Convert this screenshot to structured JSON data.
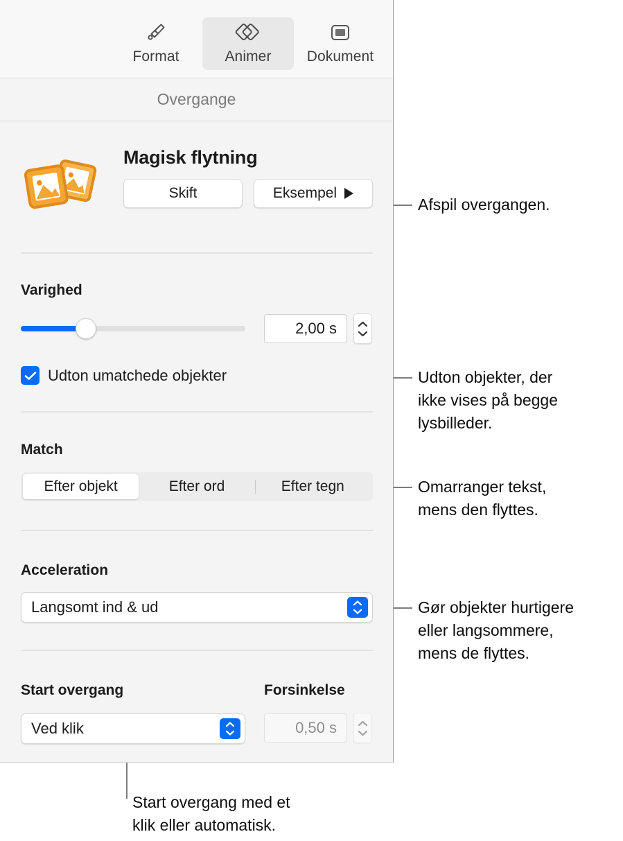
{
  "panel": {
    "tabs": [
      {
        "id": "format",
        "label": "Format",
        "icon": "paintbrush-icon",
        "selected": false
      },
      {
        "id": "animer",
        "label": "Animer",
        "icon": "overlapping-diamonds-icon",
        "selected": true
      },
      {
        "id": "dokument",
        "label": "Dokument",
        "icon": "document-slide-icon",
        "selected": false
      }
    ],
    "section_header": "Overgange",
    "transition": {
      "icon": "photos-transition-icon",
      "name": "Magisk flytning",
      "change_button": "Skift",
      "preview_button": "Eksempel",
      "preview_icon": "play-triangle-icon"
    },
    "duration": {
      "label": "Varighed",
      "value": "2,00 s",
      "slider_percent": 28,
      "stepper_icon": "stepper-chevrons-icon"
    },
    "fade_unmatched": {
      "label": "Udton umatchede objekter",
      "checked": true,
      "check_icon": "checkmark-icon"
    },
    "match": {
      "label": "Match",
      "options": [
        {
          "label": "Efter objekt",
          "selected": true
        },
        {
          "label": "Efter ord",
          "selected": false
        },
        {
          "label": "Efter tegn",
          "selected": false
        }
      ]
    },
    "acceleration": {
      "label": "Acceleration",
      "value": "Langsomt ind & ud",
      "arrow_icon": "popup-chevrons-icon"
    },
    "start_transition": {
      "label": "Start overgang",
      "value": "Ved klik",
      "arrow_icon": "popup-chevrons-icon"
    },
    "delay": {
      "label": "Forsinkelse",
      "value": "0,50 s",
      "disabled": true,
      "stepper_icon": "stepper-chevrons-icon"
    }
  },
  "colors": {
    "accent_blue": "#0a6cf5",
    "panel_background": "#f4f4f4",
    "tabbar_background": "#f8f8f8",
    "transition_icon_orange": "#f0901e",
    "leader_line": "#7d7d7d"
  },
  "callouts": [
    {
      "id": "preview",
      "text": "Afspil overgangen."
    },
    {
      "id": "fade",
      "text": "Udton objekter, der\nikke vises på begge\nlysbilleder."
    },
    {
      "id": "match",
      "text": "Omarranger tekst,\nmens den flyttes."
    },
    {
      "id": "acceleration",
      "text": "Gør objekter hurtigere\neller langsommere,\nmens de flyttes."
    },
    {
      "id": "start",
      "text": "Start overgang med et\nklik eller automatisk."
    }
  ]
}
